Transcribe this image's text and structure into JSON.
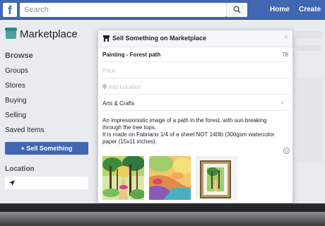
{
  "topbar": {
    "logo": "f",
    "search_placeholder": "Search",
    "nav": [
      "Home",
      "Create"
    ]
  },
  "sidebar": {
    "title": "Marketplace",
    "browse_header": "Browse",
    "items": [
      "Groups",
      "Stores",
      "Buying",
      "Selling",
      "Saved Items"
    ],
    "sell_button": "+ Sell Something",
    "location_header": "Location"
  },
  "modal": {
    "title": "Sell Something on Marketplace",
    "close": "×",
    "item_title": "Painting - Forest path",
    "char_count": "78",
    "price_placeholder": "Price",
    "location_placeholder": "Add Location",
    "category": "Arts & Crafts",
    "category_clear": "×",
    "description_lines": [
      "An impressionistic image of a path in the forest, with sun breaking",
      "through the tree tops.",
      "It is made on Fabriano 1/4 of a sheet NOT 140lb (300gsm watercolor",
      "paper (15x11 inches)."
    ]
  },
  "colors": {
    "brand": "#4267b2",
    "background": "#e9ebee"
  },
  "icons": [
    "facebook-logo-icon",
    "search-icon",
    "marketplace-shop-icon",
    "location-arrow-icon",
    "pin-icon",
    "emoji-icon",
    "close-icon"
  ]
}
